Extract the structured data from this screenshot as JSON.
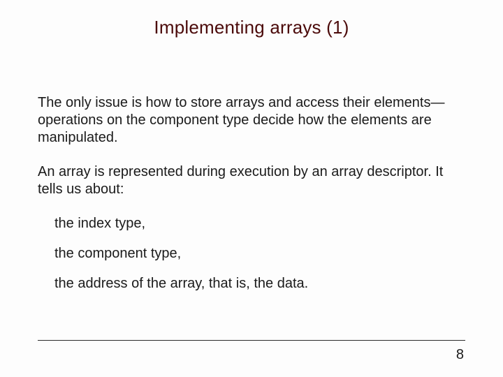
{
  "title": "Implementing arrays (1)",
  "paragraphs": {
    "p1": "The only issue is how to store arrays and access their elements—operations on the component type decide how the elements are manipulated.",
    "p2": "An array is represented during execution by an array descriptor. It tells us about:"
  },
  "bullets": {
    "b1": "the index type,",
    "b2": "the component type,",
    "b3": "the address of the array, that is, the data."
  },
  "page_number": "8"
}
